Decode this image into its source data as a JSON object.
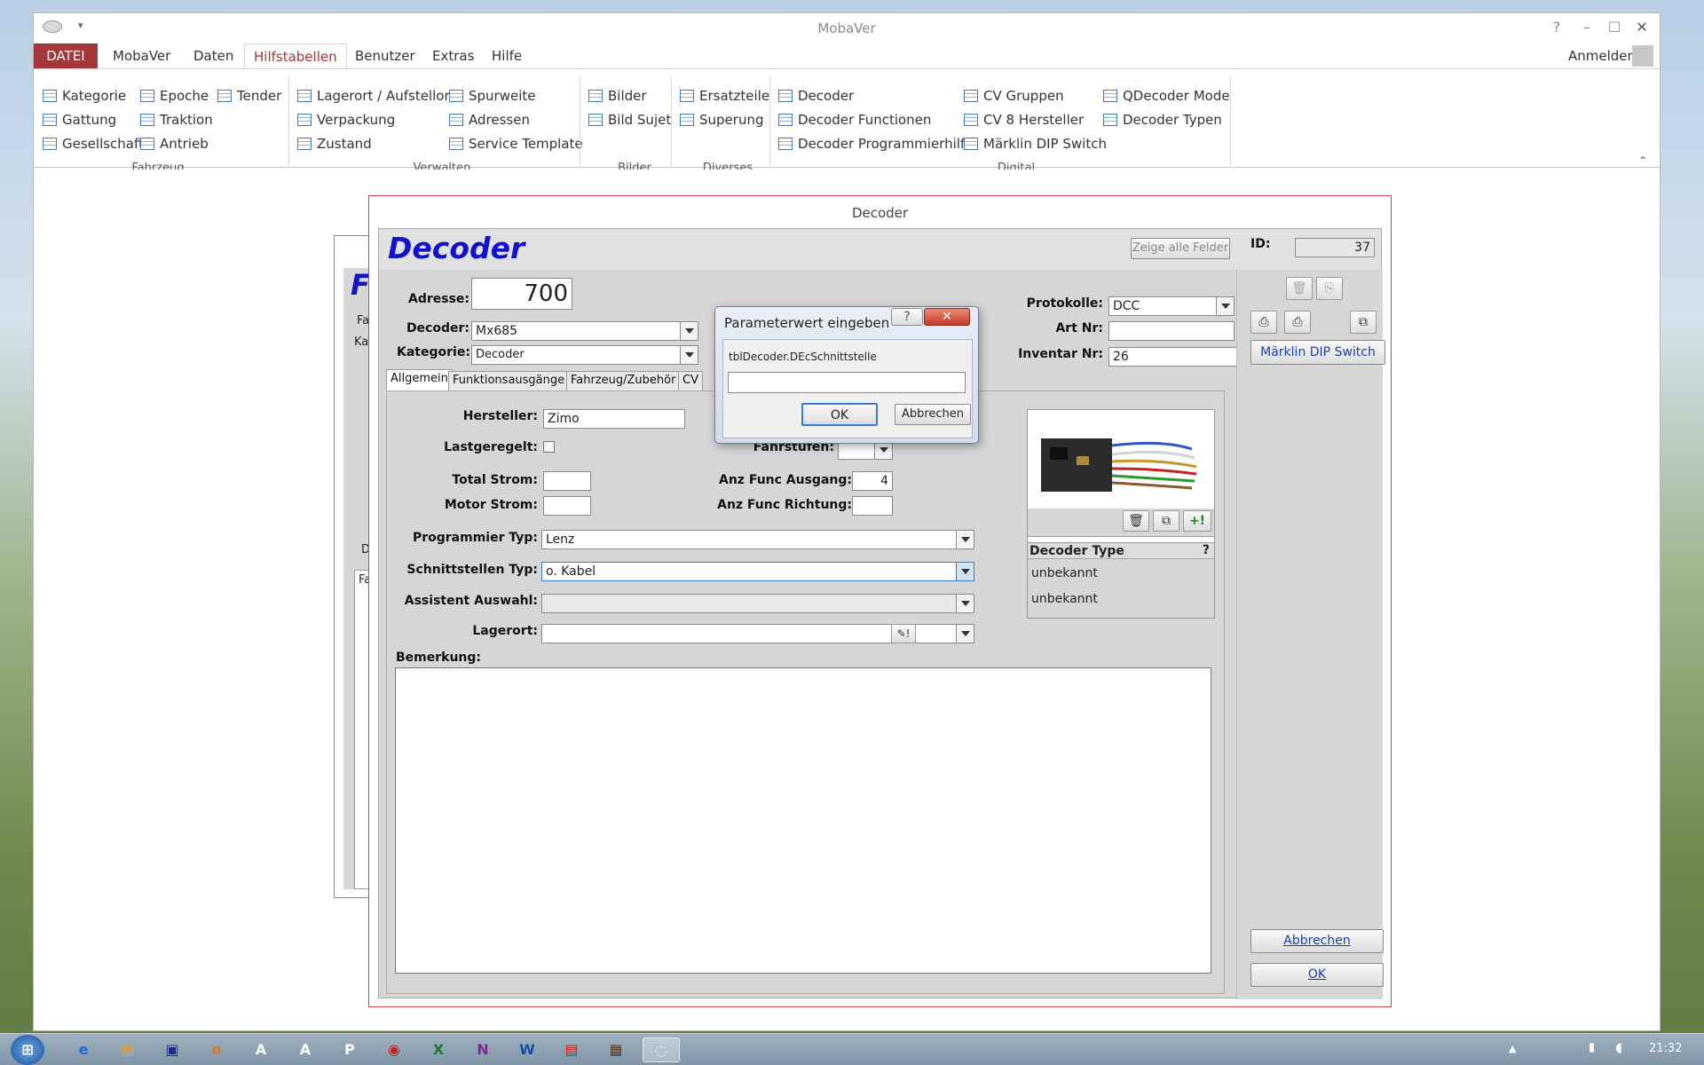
{
  "window": {
    "title": "MobaVer",
    "help": "?",
    "minimize": "–",
    "maximize": "☐",
    "close": "✕",
    "signin": "Anmelden"
  },
  "menu": [
    {
      "label": "DATEI"
    },
    {
      "label": "MobaVer"
    },
    {
      "label": "Daten"
    },
    {
      "label": "Hilfstabellen"
    },
    {
      "label": "Benutzer"
    },
    {
      "label": "Extras"
    },
    {
      "label": "Hilfe"
    }
  ],
  "ribbon": {
    "fahrzeug": {
      "group": "Fahrzeug",
      "items": [
        "Kategorie",
        "Gattung",
        "Gesellschaft",
        "Epoche",
        "Traktion",
        "Antrieb",
        "Tender"
      ]
    },
    "verwalten": {
      "group": "Verwalten",
      "items": [
        "Lagerort / Aufstellort",
        "Verpackung",
        "Zustand",
        "Spurweite",
        "Adressen",
        "Service Template"
      ]
    },
    "bilder": {
      "group": "Bilder",
      "items": [
        "Bilder",
        "Bild Sujet"
      ]
    },
    "diverses": {
      "group": "Diverses",
      "items": [
        "Ersatzteile",
        "Superung"
      ]
    },
    "digital": {
      "group": "Digital",
      "items": [
        "Decoder",
        "Decoder Functionen",
        "Decoder Programmierhilfe",
        "CV Gruppen",
        "CV 8 Hersteller",
        "Märklin DIP Switch",
        "QDecoder Mode",
        "Decoder Typen"
      ]
    }
  },
  "decoder_form": {
    "caption": "Decoder",
    "heading": "Decoder",
    "show_all_fields": "Zeige alle Felder",
    "id_label": "ID:",
    "id_value": "37",
    "adresse_label": "Adresse:",
    "adresse_value": "700",
    "decoder_label": "Decoder:",
    "decoder_value": "Mx685",
    "kategorie_label": "Kategorie:",
    "kategorie_value": "Decoder",
    "protokolle_label": "Protokolle:",
    "protokolle_value": "DCC",
    "artnr_label": "Art Nr:",
    "artnr_value": "",
    "inventar_label": "Inventar Nr:",
    "inventar_value": "26",
    "dip_button": "Märklin DIP Switch",
    "tabs": [
      "Allgemein",
      "Funktionsausgänge",
      "Fahrzeug/Zubehör",
      "CV"
    ],
    "hersteller_label": "Hersteller:",
    "hersteller_value": "Zimo",
    "lastgeregelt_label": "Lastgeregelt:",
    "fahrstufen_label": "Fahrstufen:",
    "fahrstufen_value": "",
    "total_strom_label": "Total Strom:",
    "total_strom_value": "",
    "motor_strom_label": "Motor Strom:",
    "motor_strom_value": "",
    "anz_func_ausgang_label": "Anz Func Ausgang:",
    "anz_func_ausgang_value": "4",
    "anz_func_richtung_label": "Anz Func Richtung:",
    "anz_func_richtung_value": "",
    "programmier_label": "Programmier Typ:",
    "programmier_value": "Lenz",
    "schnittstellen_label": "Schnittstellen Typ:",
    "schnittstellen_value": "o. Kabel",
    "assistent_label": "Assistent Auswahl:",
    "assistent_value": "",
    "lagerort_label": "Lagerort:",
    "lagerort_value": "",
    "bemerkung_label": "Bemerkung:",
    "decoder_type_header": "Decoder Type",
    "decoder_type_help": "?",
    "decoder_type_1": "unbekannt",
    "decoder_type_2": "unbekannt",
    "abbrechen": "Abbrechen",
    "ok": "OK"
  },
  "background_form": {
    "title_letter": "F",
    "labels": [
      "Fa",
      "Ka",
      "D",
      "Fa"
    ]
  },
  "dialog": {
    "title": "Parameterwert eingeben",
    "help": "?",
    "close": "✕",
    "prompt": "tblDecoder.DEcSchnittstelle",
    "input_value": "",
    "ok": "OK",
    "cancel": "Abbrechen"
  },
  "taskbar": {
    "clock": "21:32"
  },
  "colors": {
    "accent": "#a4373a",
    "heading_blue": "#1212c8",
    "form_border": "#cc4444"
  }
}
